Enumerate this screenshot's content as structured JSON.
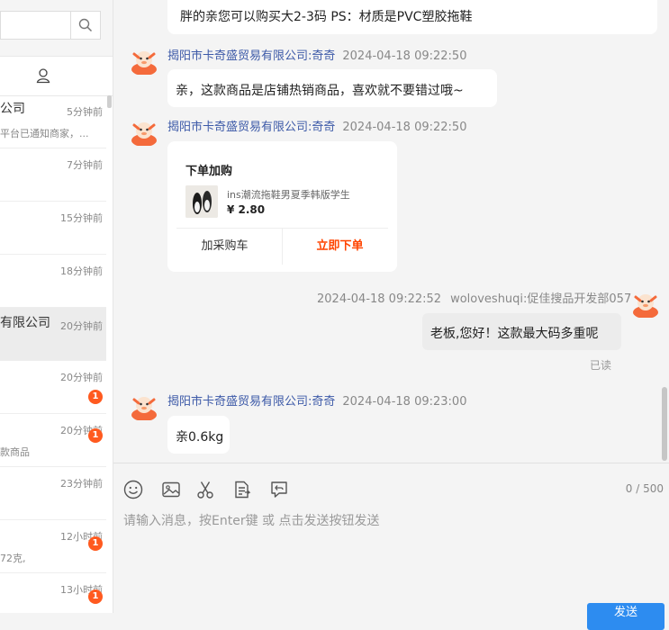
{
  "sidebar": {
    "search": {
      "placeholder": ""
    },
    "conversations": [
      {
        "name": "公司",
        "time": "5分钟前",
        "preview": "平台已通知商家，...",
        "badge": ""
      },
      {
        "name": "",
        "time": "7分钟前",
        "preview": "",
        "badge": ""
      },
      {
        "name": "",
        "time": "15分钟前",
        "preview": "",
        "badge": ""
      },
      {
        "name": "",
        "time": "18分钟前",
        "preview": "",
        "badge": ""
      },
      {
        "name": "有限公司",
        "time": "20分钟前",
        "preview": "",
        "badge": ""
      },
      {
        "name": "",
        "time": "20分钟前",
        "preview": "",
        "badge": "1"
      },
      {
        "name": "",
        "time": "20分钟前",
        "preview": "款商品",
        "badge": "1"
      },
      {
        "name": "",
        "time": "23分钟前",
        "preview": "",
        "badge": ""
      },
      {
        "name": "",
        "time": "12小时前",
        "preview": "72克,",
        "badge": "1"
      },
      {
        "name": "",
        "time": "13小时前",
        "preview": "",
        "badge": "1"
      }
    ]
  },
  "chat": {
    "messages": {
      "m0": {
        "text": "胖的亲您可以购买大2-3码 PS：材质是PVC塑胶拖鞋"
      },
      "m1": {
        "sender": "揭阳市卡奇盛贸易有限公司:奇奇",
        "time": "2024-04-18 09:22:50",
        "text": "亲，这款商品是店铺热销商品，喜欢就不要错过哦~"
      },
      "m2": {
        "sender": "揭阳市卡奇盛贸易有限公司:奇奇",
        "time": "2024-04-18 09:22:50"
      },
      "m3": {
        "time": "2024-04-18 09:22:52",
        "sender": "woloveshuqi:促佳搜品开发部057",
        "text": "老板,您好！这款最大码多重呢",
        "status": "已读"
      },
      "m4": {
        "sender": "揭阳市卡奇盛贸易有限公司:奇奇",
        "time": "2024-04-18 09:23:00",
        "text": "亲0.6kg"
      }
    },
    "product_card": {
      "title": "下单加购",
      "product_name": "ins潮流拖鞋男夏季韩版学生",
      "price": "¥ 2.80",
      "cart_label": "加采购车",
      "order_label": "立即下单"
    }
  },
  "composer": {
    "counter": "0 / 500",
    "placeholder": "请输入消息，按Enter键 或 点击发送按钮发送",
    "send_label": "发送",
    "tools": [
      "emoji-icon",
      "image-icon",
      "scissors-icon",
      "order-list-icon",
      "quick-reply-icon"
    ]
  },
  "colors": {
    "accent": "#2d8cf0",
    "sender": "#3d5aa8",
    "badge": "#ff5a1f",
    "order": "#ff4400"
  }
}
